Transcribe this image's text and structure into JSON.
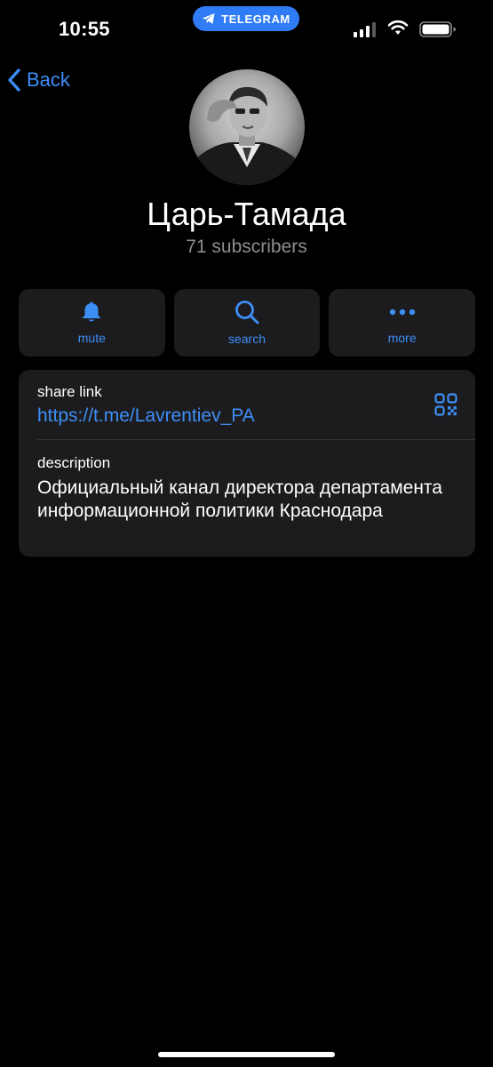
{
  "status_bar": {
    "time": "10:55",
    "app_pill_label": "TELEGRAM",
    "signal_icon": "cellular-signal-icon",
    "wifi_icon": "wifi-icon",
    "battery_icon": "battery-icon"
  },
  "nav": {
    "back_label": "Back",
    "back_icon": "chevron-left-icon"
  },
  "channel": {
    "name": "Царь-Тамада",
    "subscribers": "71 subscribers",
    "avatar": "channel-avatar-photo"
  },
  "actions": [
    {
      "label": "mute",
      "icon": "bell-icon"
    },
    {
      "label": "search",
      "icon": "search-icon"
    },
    {
      "label": "more",
      "icon": "ellipsis-icon"
    }
  ],
  "info": {
    "share_link_label": "share link",
    "share_link": "https://t.me/Lavrentiev_PA",
    "qr_icon": "qr-code-icon",
    "description_label": "description",
    "description": "Официальный канал директора департамента информационной политики Краснодара"
  },
  "colors": {
    "background": "#000000",
    "card": "#1c1c1e",
    "accent": "#3e8ef7",
    "secondary_text": "#8d8d92",
    "pill": "#2f7cf6"
  }
}
